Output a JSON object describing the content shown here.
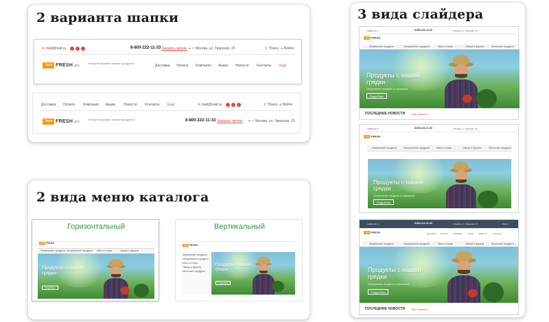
{
  "cards": {
    "headers_title": "2 варианта шапки",
    "menus_title": "2 вида меню каталога",
    "sliders_title": "3 вида слайдера"
  },
  "site": {
    "logo_box": "Твой",
    "logo_text": "FRESH",
    "logo_pro": ".pro",
    "tagline": "Интернет-магазин свежих продуктов",
    "email": "mail@mail.ru",
    "phone": "8-800-222-11-33",
    "callback": "Заказать звонок",
    "address": "г. Москва, ул. Тверская, 25",
    "search": "Поиск",
    "login": "Войти",
    "nav": [
      "Доставка",
      "Оплата",
      "Компания",
      "Акции",
      "Новости",
      "Контакты",
      "Ещё"
    ]
  },
  "catalog_menus": {
    "horizontal": "Горизонтальный",
    "vertical": "Вертикальный",
    "categories": [
      "Фермерские продукты",
      "Натуральные продукты",
      "Мясо и птица",
      "Овощи и фрукты",
      "Молочные продукты"
    ]
  },
  "slider": {
    "headline_line1": "Продукты с нашей",
    "headline_line2": "грядки",
    "subtitle": "Натуральные продукты от фермеров",
    "button": "Подробнее",
    "news": "ПОСЛЕДНИЕ НОВОСТИ",
    "all_news": "Все новости"
  },
  "colors": {
    "accent": "#e8463a",
    "orange": "#f29a1e",
    "green": "#2f9a3a",
    "dark_header": "#3d4d5e"
  }
}
